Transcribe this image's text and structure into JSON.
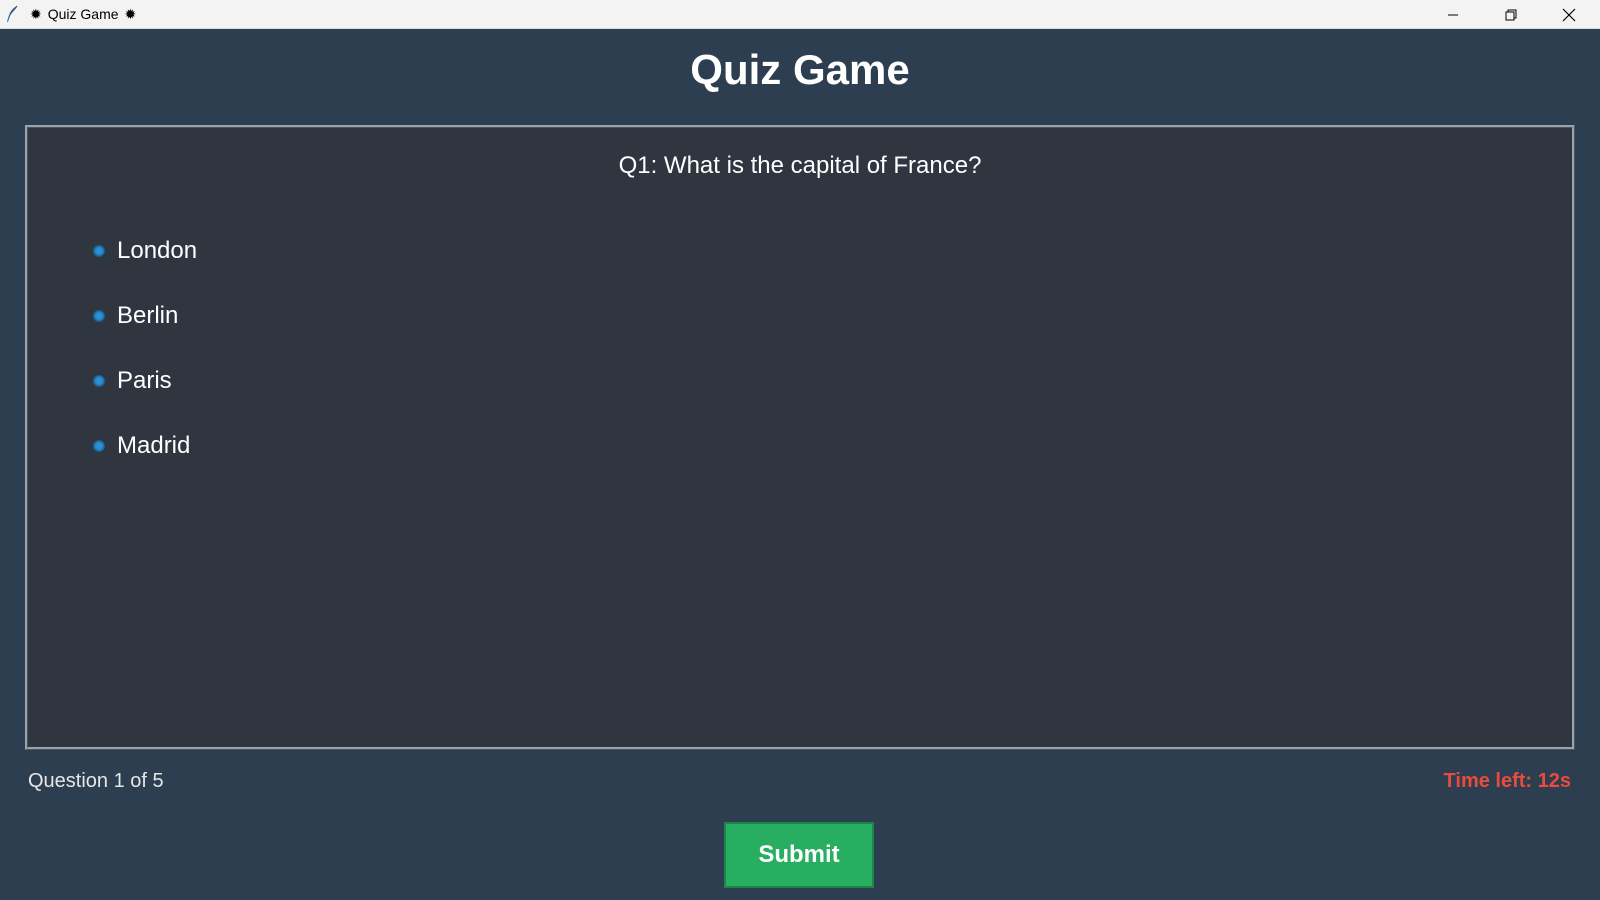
{
  "window": {
    "title": "Quiz Game",
    "icon": "feather-icon",
    "decor_icon": "gear-icon",
    "controls": [
      "minimize-icon",
      "restore-icon",
      "close-icon"
    ]
  },
  "header": {
    "title": "Quiz Game"
  },
  "question": {
    "text": "Q1: What is the capital of France?",
    "options": [
      {
        "label": "London"
      },
      {
        "label": "Berlin"
      },
      {
        "label": "Paris"
      },
      {
        "label": "Madrid"
      }
    ]
  },
  "footer": {
    "progress": "Question 1 of 5",
    "timer": "Time left: 12s",
    "submit_label": "Submit"
  },
  "colors": {
    "background": "#2c3e50",
    "panel": "#2f3640",
    "radio": "#2d8fd5",
    "submit": "#27ae60",
    "timer": "#e74c3c"
  }
}
